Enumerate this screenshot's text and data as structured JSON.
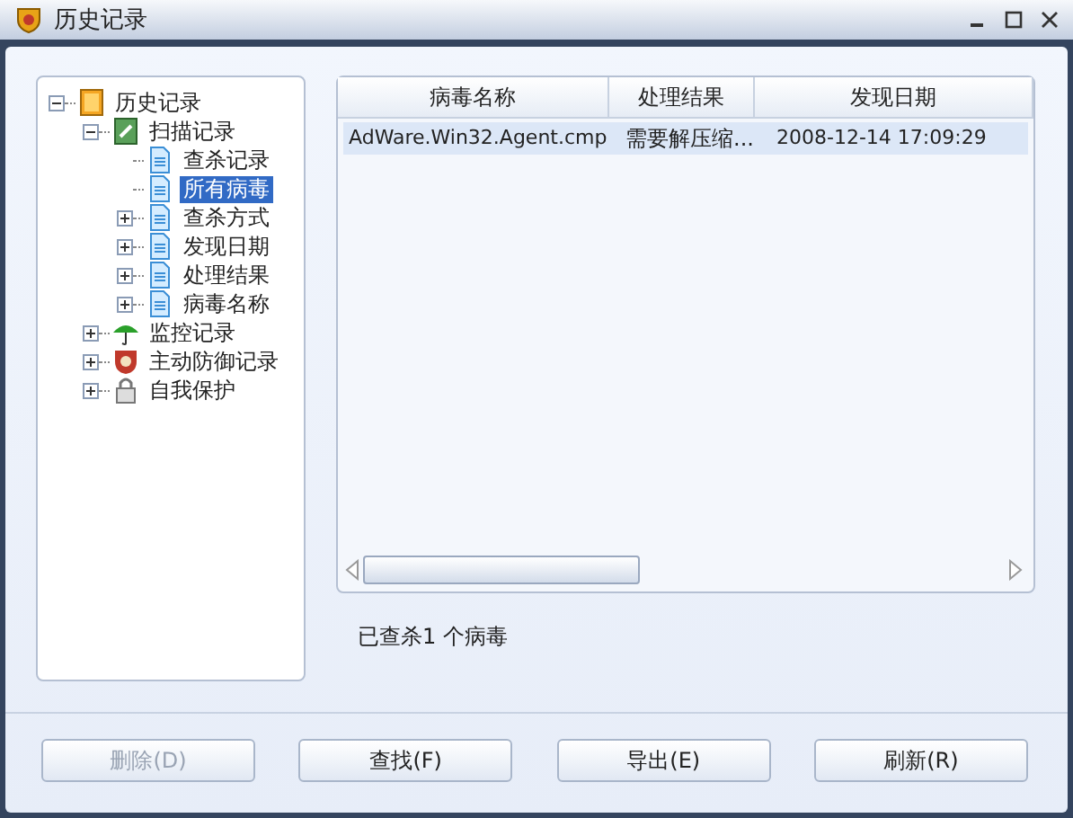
{
  "window": {
    "title": "历史记录"
  },
  "tree": [
    {
      "label": "历史记录",
      "kind": "folder",
      "expanded": true,
      "selected": false,
      "children": [
        {
          "label": "扫描记录",
          "kind": "scan",
          "expanded": true,
          "selected": false,
          "children": [
            {
              "label": "查杀记录",
              "kind": "doc",
              "selected": false
            },
            {
              "label": "所有病毒",
              "kind": "doc",
              "selected": true
            },
            {
              "label": "查杀方式",
              "kind": "doc",
              "expanded": false,
              "selected": false
            },
            {
              "label": "发现日期",
              "kind": "doc",
              "expanded": false,
              "selected": false
            },
            {
              "label": "处理结果",
              "kind": "doc",
              "expanded": false,
              "selected": false
            },
            {
              "label": "病毒名称",
              "kind": "doc",
              "expanded": false,
              "selected": false
            }
          ]
        },
        {
          "label": "监控记录",
          "kind": "umbrella",
          "expanded": false,
          "selected": false
        },
        {
          "label": "主动防御记录",
          "kind": "shield",
          "expanded": false,
          "selected": false
        },
        {
          "label": "自我保护",
          "kind": "lock",
          "expanded": false,
          "selected": false
        }
      ]
    }
  ],
  "table": {
    "columns": [
      "病毒名称",
      "处理结果",
      "发现日期"
    ],
    "rows": [
      {
        "cells": [
          "AdWare.Win32.Agent.cmp",
          "需要解压缩...",
          "2008-12-14 17:09:29"
        ],
        "selected": true
      }
    ]
  },
  "status": "已查杀1 个病毒",
  "buttons": [
    {
      "label": "删除(D)",
      "disabled": true
    },
    {
      "label": "查找(F)",
      "disabled": false
    },
    {
      "label": "导出(E)",
      "disabled": false
    },
    {
      "label": "刷新(R)",
      "disabled": false
    }
  ]
}
